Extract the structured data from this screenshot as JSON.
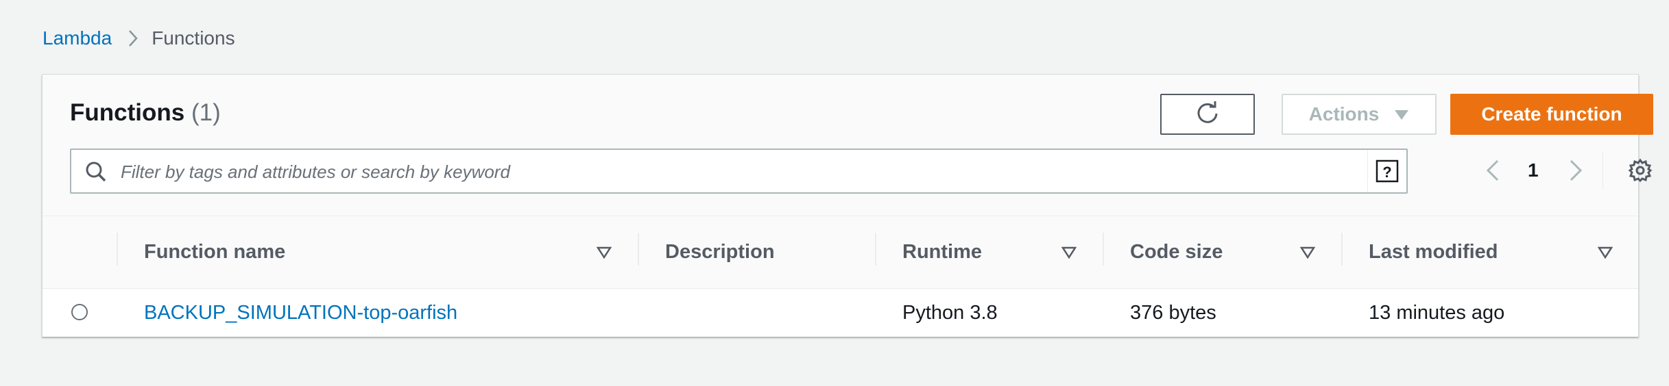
{
  "breadcrumb": {
    "root": "Lambda",
    "current": "Functions"
  },
  "panel": {
    "title": "Functions",
    "count": "(1)",
    "actions_label": "Actions",
    "create_label": "Create function",
    "search": {
      "placeholder": "Filter by tags and attributes or search by keyword",
      "value": ""
    },
    "pagination": {
      "current_page": "1"
    }
  },
  "table": {
    "columns": [
      "Function name",
      "Description",
      "Runtime",
      "Code size",
      "Last modified"
    ],
    "rows": [
      {
        "name": "BACKUP_SIMULATION-top-oarfish",
        "description": "",
        "runtime": "Python 3.8",
        "code_size": "376 bytes",
        "last_modified": "13 minutes ago"
      }
    ]
  },
  "colors": {
    "link": "#0073bb",
    "primary": "#ec7211",
    "background": "#f2f3f3"
  },
  "icons": [
    "chevron-right-icon",
    "refresh-icon",
    "caret-down-icon",
    "search-icon",
    "help-icon",
    "chevron-left-icon",
    "gear-icon",
    "sort-icon"
  ]
}
